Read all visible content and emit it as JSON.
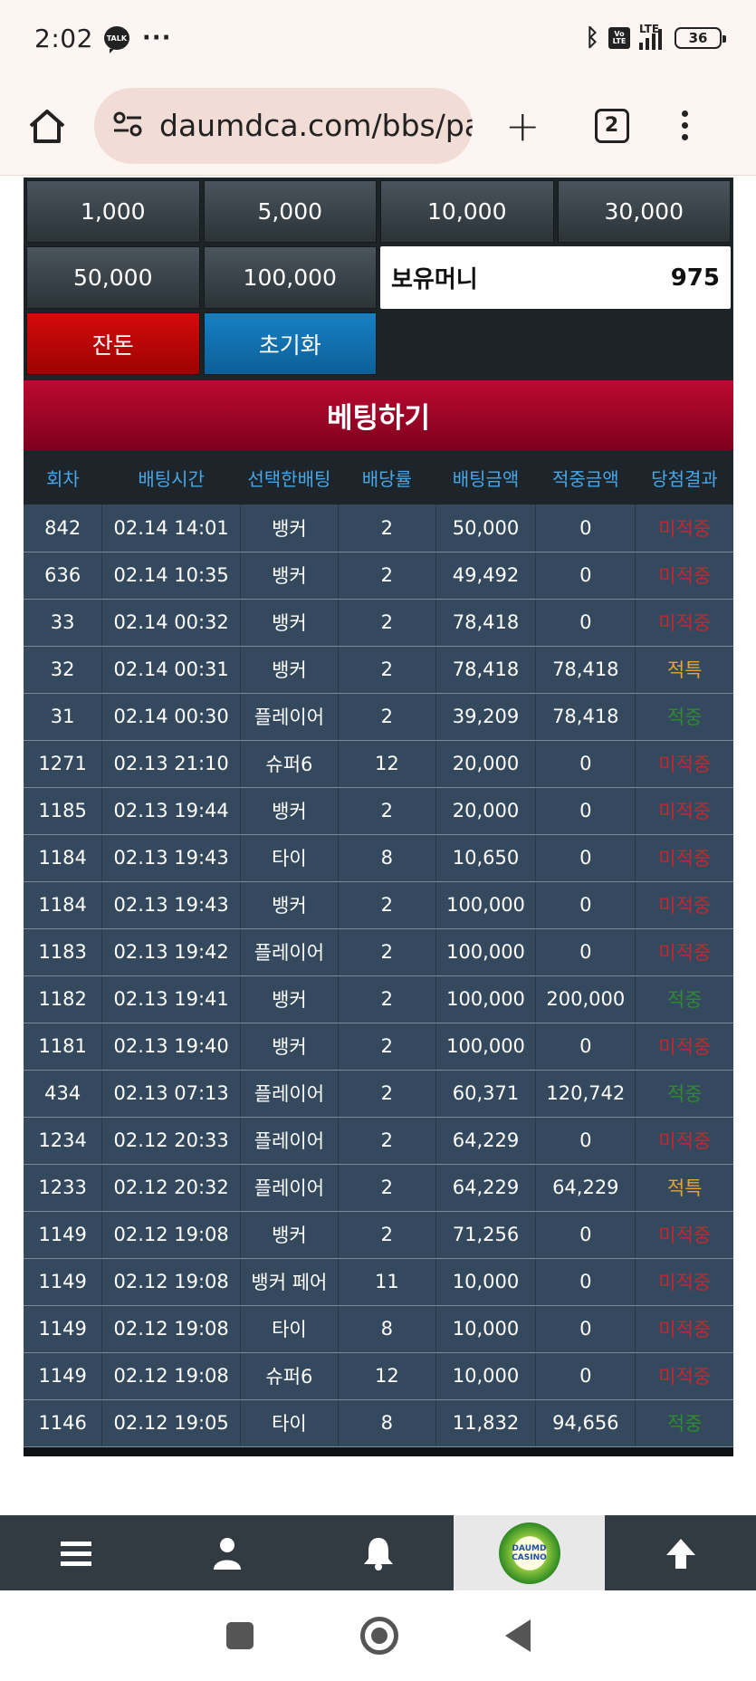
{
  "status_bar": {
    "time": "2:02",
    "talk_label": "TALK",
    "more": "···",
    "volte": "Vo LTE",
    "lte": "LTE",
    "battery": "36"
  },
  "browser": {
    "url": "daumdca.com/bbs/pa",
    "tab_count": "2"
  },
  "chips": {
    "c1": "1,000",
    "c2": "5,000",
    "c3": "10,000",
    "c4": "30,000",
    "c5": "50,000",
    "c6": "100,000"
  },
  "balance": {
    "label": "보유머니",
    "value": "975"
  },
  "actions": {
    "change": "잔돈",
    "reset": "초기화"
  },
  "bet_title": "베팅하기",
  "table": {
    "headers": [
      "회차",
      "배팅시간",
      "선택한배팅",
      "배당률",
      "배팅금액",
      "적중금액",
      "당첨결과"
    ],
    "rows": [
      [
        "842",
        "02.14 14:01",
        "뱅커",
        "2",
        "50,000",
        "0",
        "미적중"
      ],
      [
        "636",
        "02.14 10:35",
        "뱅커",
        "2",
        "49,492",
        "0",
        "미적중"
      ],
      [
        "33",
        "02.14 00:32",
        "뱅커",
        "2",
        "78,418",
        "0",
        "미적중"
      ],
      [
        "32",
        "02.14 00:31",
        "뱅커",
        "2",
        "78,418",
        "78,418",
        "적특"
      ],
      [
        "31",
        "02.14 00:30",
        "플레이어",
        "2",
        "39,209",
        "78,418",
        "적중"
      ],
      [
        "1271",
        "02.13 21:10",
        "슈퍼6",
        "12",
        "20,000",
        "0",
        "미적중"
      ],
      [
        "1185",
        "02.13 19:44",
        "뱅커",
        "2",
        "20,000",
        "0",
        "미적중"
      ],
      [
        "1184",
        "02.13 19:43",
        "타이",
        "8",
        "10,650",
        "0",
        "미적중"
      ],
      [
        "1184",
        "02.13 19:43",
        "뱅커",
        "2",
        "100,000",
        "0",
        "미적중"
      ],
      [
        "1183",
        "02.13 19:42",
        "플레이어",
        "2",
        "100,000",
        "0",
        "미적중"
      ],
      [
        "1182",
        "02.13 19:41",
        "뱅커",
        "2",
        "100,000",
        "200,000",
        "적중"
      ],
      [
        "1181",
        "02.13 19:40",
        "뱅커",
        "2",
        "100,000",
        "0",
        "미적중"
      ],
      [
        "434",
        "02.13 07:13",
        "플레이어",
        "2",
        "60,371",
        "120,742",
        "적중"
      ],
      [
        "1234",
        "02.12 20:33",
        "플레이어",
        "2",
        "64,229",
        "0",
        "미적중"
      ],
      [
        "1233",
        "02.12 20:32",
        "플레이어",
        "2",
        "64,229",
        "64,229",
        "적특"
      ],
      [
        "1149",
        "02.12 19:08",
        "뱅커",
        "2",
        "71,256",
        "0",
        "미적중"
      ],
      [
        "1149",
        "02.12 19:08",
        "뱅커 페어",
        "11",
        "10,000",
        "0",
        "미적중"
      ],
      [
        "1149",
        "02.12 19:08",
        "타이",
        "8",
        "10,000",
        "0",
        "미적중"
      ],
      [
        "1149",
        "02.12 19:08",
        "슈퍼6",
        "12",
        "10,000",
        "0",
        "미적중"
      ],
      [
        "1146",
        "02.12 19:05",
        "타이",
        "8",
        "11,832",
        "94,656",
        "적중"
      ]
    ]
  },
  "logo_text": "DAUMD CASINO",
  "colors": {
    "result_miss": "#c7262e",
    "result_special": "#e8a52a",
    "result_hit": "#2e8b2e",
    "header_text": "#48a6e6"
  }
}
